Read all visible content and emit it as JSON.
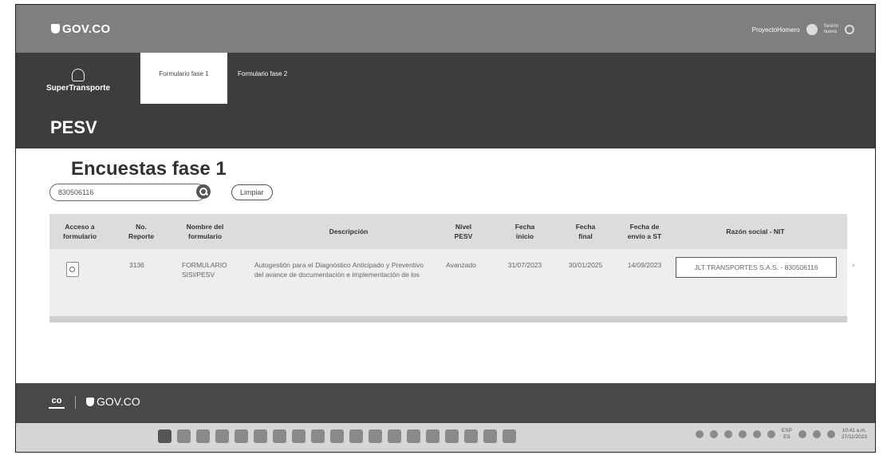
{
  "header": {
    "gov_logo": "GOV.CO",
    "user_name": "ProyectoHomero",
    "user_mini": "Sesión\nnueva"
  },
  "nav": {
    "brand_name": "SuperTransporte",
    "tabs": [
      {
        "label": "Formulario fase 1",
        "active": true
      },
      {
        "label": "Formulario fase 2",
        "active": false
      }
    ],
    "app_title": "PESV"
  },
  "main": {
    "page_title": "Encuestas fase 1",
    "search": {
      "value": "830506116"
    },
    "clear_label": "Limpiar",
    "table": {
      "columns": [
        "Acceso a\nformulario",
        "No.\nReporte",
        "Nombre del\nformulario",
        "Descripción",
        "Nivel\nPESV",
        "Fecha\ninicio",
        "Fecha\nfinal",
        "Fecha de\nenvío a ST",
        "Razón social - NIT"
      ],
      "rows": [
        {
          "reporte": "3136",
          "nombre": "FORMULARIO\nSISI/PESV",
          "descripcion": "Autogestión para el Diagnóstico Anticipado y Preventivo del avance de documentación e implementación de los",
          "nivel": "Avanzado",
          "fecha_inicio": "31/07/2023",
          "fecha_final": "30/01/2025",
          "fecha_envio": "14/09/2023",
          "razon_social": "JLT TRANSPORTES S.A.S. - 830506116"
        }
      ]
    }
  },
  "footer": {
    "co_label": "co",
    "gov_logo": "GOV.CO"
  },
  "taskbar": {
    "lang": "ESP\nES",
    "time": "10:41 a.m.",
    "date": "27/11/2023"
  },
  "colors": {
    "topbar": "#7f7f7f",
    "navband": "#3d3d3d",
    "footer": "#484848",
    "table_header": "#dcdcdc",
    "taskbar": "#d6d6d6"
  }
}
